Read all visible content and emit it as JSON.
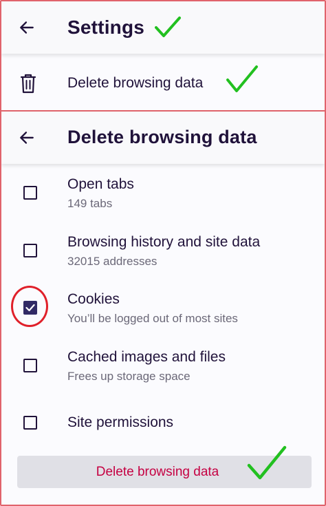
{
  "settings_bar": {
    "title": "Settings",
    "back_icon": "arrow-left-icon"
  },
  "settings_row": {
    "label": "Delete browsing data",
    "icon": "trash-icon"
  },
  "delete_bar": {
    "title": "Delete browsing data",
    "back_icon": "arrow-left-icon"
  },
  "options": [
    {
      "title": "Open tabs",
      "subtitle": "149 tabs",
      "checked": false
    },
    {
      "title": "Browsing history and site data",
      "subtitle": "32015 addresses",
      "checked": false
    },
    {
      "title": "Cookies",
      "subtitle": "You’ll be logged out of most sites",
      "checked": true
    },
    {
      "title": "Cached images and files",
      "subtitle": "Frees up storage space",
      "checked": false
    },
    {
      "title": "Site permissions",
      "subtitle": "",
      "checked": false
    }
  ],
  "action": {
    "label": "Delete browsing data"
  },
  "colors": {
    "accent": "#312a65",
    "destructive_text": "#c50042",
    "annotation_green": "#22c020",
    "annotation_red": "#e0202a"
  }
}
